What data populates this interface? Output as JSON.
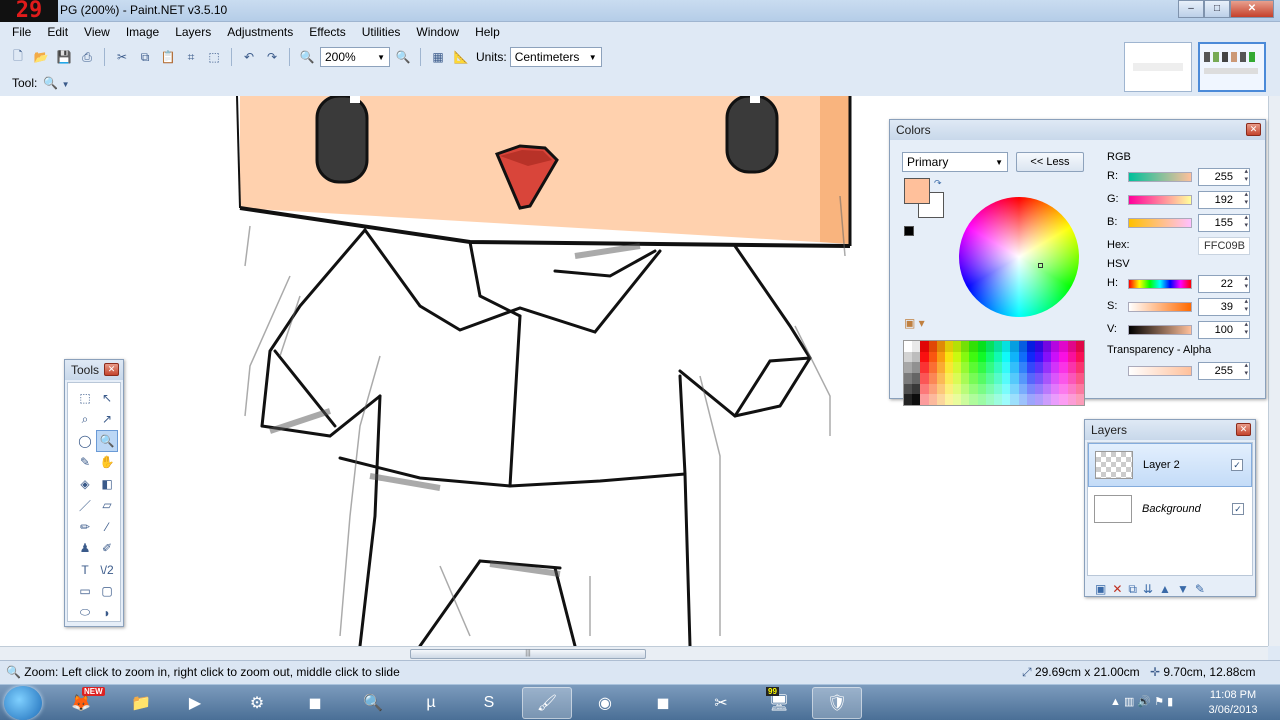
{
  "window": {
    "fps_counter": "29",
    "title": "PG (200%) - Paint.NET v3.5.10",
    "min": "–",
    "max": "□",
    "close": "✕"
  },
  "menu": [
    "File",
    "Edit",
    "View",
    "Image",
    "Layers",
    "Adjustments",
    "Effects",
    "Utilities",
    "Window",
    "Help"
  ],
  "toolbar": {
    "zoom_value": "200%",
    "units_label": "Units:",
    "units_value": "Centimeters"
  },
  "tool_row": {
    "label": "Tool:",
    "current_tool_icon": "magnifier-icon"
  },
  "tools_window": {
    "title": "Tools",
    "tools": [
      {
        "name": "rectangle-select-icon",
        "glyph": "⬚"
      },
      {
        "name": "move-selection-icon",
        "glyph": "↖"
      },
      {
        "name": "lasso-select-icon",
        "glyph": "⌕"
      },
      {
        "name": "move-selection-outline-icon",
        "glyph": "↗"
      },
      {
        "name": "ellipse-select-icon",
        "glyph": "◯"
      },
      {
        "name": "zoom-icon",
        "glyph": "🔍",
        "selected": true
      },
      {
        "name": "magic-wand-icon",
        "glyph": "✎"
      },
      {
        "name": "pan-hand-icon",
        "glyph": "✋"
      },
      {
        "name": "paint-bucket-icon",
        "glyph": "◈"
      },
      {
        "name": "gradient-icon",
        "glyph": "◧"
      },
      {
        "name": "paintbrush-icon",
        "glyph": "／"
      },
      {
        "name": "eraser-icon",
        "glyph": "▱"
      },
      {
        "name": "pencil-icon",
        "glyph": "✏"
      },
      {
        "name": "color-picker-icon",
        "glyph": "⁄"
      },
      {
        "name": "clone-stamp-icon",
        "glyph": "♟"
      },
      {
        "name": "recolor-icon",
        "glyph": "✐"
      },
      {
        "name": "text-icon",
        "glyph": "T"
      },
      {
        "name": "line-curve-icon",
        "glyph": "\\/2"
      },
      {
        "name": "rectangle-icon",
        "glyph": "▭"
      },
      {
        "name": "rounded-rectangle-icon",
        "glyph": "▢"
      },
      {
        "name": "ellipse-icon",
        "glyph": "⬭"
      },
      {
        "name": "freeform-shape-icon",
        "glyph": "◗"
      }
    ]
  },
  "colors_window": {
    "title": "Colors",
    "mode": "Primary",
    "less_button": "<< Less",
    "rgb_label": "RGB",
    "r_label": "R:",
    "r_value": "255",
    "g_label": "G:",
    "g_value": "192",
    "b_label": "B:",
    "b_value": "155",
    "hex_label": "Hex:",
    "hex_value": "FFC09B",
    "hsv_label": "HSV",
    "h_label": "H:",
    "h_value": "22",
    "s_label": "S:",
    "s_value": "39",
    "v_label": "V:",
    "v_value": "100",
    "alpha_label": "Transparency - Alpha",
    "alpha_value": "255",
    "primary_color": "#FFC09B",
    "secondary_color": "#FFFFFF"
  },
  "layers_window": {
    "title": "Layers",
    "layers": [
      {
        "name": "Layer 2",
        "visible": true,
        "selected": true
      },
      {
        "name": "Background",
        "visible": true,
        "selected": false
      }
    ]
  },
  "status": {
    "hint": "Zoom: Left click to zoom in, right click to zoom out, middle click to slide",
    "image_size": "29.69cm x 21.00cm",
    "cursor_pos": "9.70cm, 12.88cm"
  },
  "taskbar": {
    "time": "11:08 PM",
    "date": "3/06/2013",
    "new_badge": "NEW",
    "fraps_badge": "99"
  },
  "colors": {
    "skin": "#FFD1AE",
    "skin_shade": "#F7A86A",
    "mouth": "#D9453A",
    "eye": "#3A3A3A",
    "accent": "#4B8AD8"
  }
}
